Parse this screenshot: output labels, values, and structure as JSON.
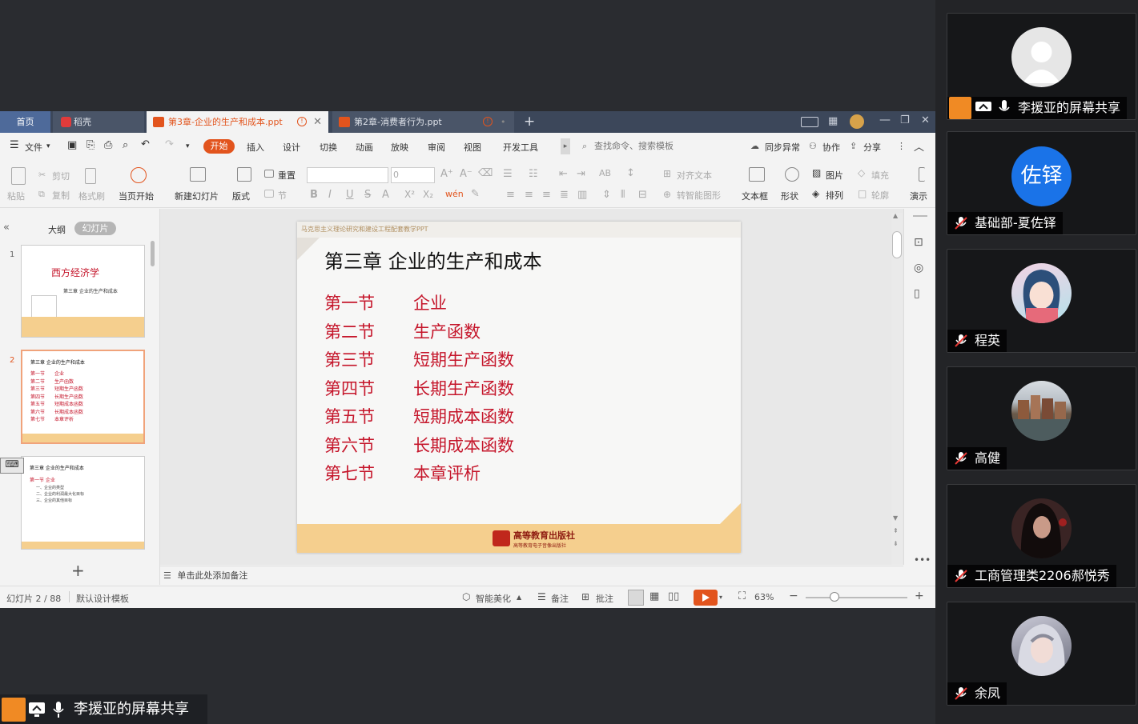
{
  "wps": {
    "tabs": {
      "home": "首页",
      "docer": "稻壳",
      "active": "第3章-企业的生产和成本.ppt",
      "second": "第2章-消费者行为.ppt"
    },
    "menu": {
      "file": "文件",
      "items": [
        "开始",
        "插入",
        "设计",
        "切换",
        "动画",
        "放映",
        "审阅",
        "视图",
        "开发工具"
      ],
      "search_placeholder": "查找命令、搜索模板",
      "sync": "同步异常",
      "collab": "协作",
      "share": "分享"
    },
    "ribbon": {
      "paste": "粘贴",
      "cut": "剪切",
      "copy": "复制",
      "format_painter": "格式刷",
      "from_current": "当页开始",
      "new_slide": "新建幻灯片",
      "layout": "版式",
      "section": "节",
      "reset": "重置",
      "font_size": "0",
      "align_text": "对齐文本",
      "convert_shape": "转智能图形",
      "textbox": "文本框",
      "shape": "形状",
      "picture": "图片",
      "arrange": "排列",
      "fill": "填充",
      "outline": "轮廓",
      "present": "演示"
    },
    "left_panel": {
      "tab_outline": "大纲",
      "tab_slides": "幻灯片",
      "thumb1_title": "西方经济学",
      "thumb1_sub": "第三章  企业的生产和成本",
      "thumb2_title": "第三章  企业的生产和成本",
      "thumb3_title": "第三章  企业的生产和成本",
      "thumb3_sub": "第一节  企业",
      "thumb3_lines": [
        "一、企业的类型",
        "二、企业的利润最大化目标",
        "三、企业的其他目标"
      ]
    },
    "slide": {
      "header": "马克思主义理论研究和建设工程配套教学PPT",
      "title": "第三章   企业的生产和成本",
      "sections": [
        {
          "num": "第一节",
          "name": "企业"
        },
        {
          "num": "第二节",
          "name": "生产函数"
        },
        {
          "num": "第三节",
          "name": "短期生产函数"
        },
        {
          "num": "第四节",
          "name": "长期生产函数"
        },
        {
          "num": "第五节",
          "name": "短期成本函数"
        },
        {
          "num": "第六节",
          "name": "长期成本函数"
        },
        {
          "num": "第七节",
          "name": "本章评析"
        }
      ],
      "publisher": "高等教育出版社",
      "publisher_sub": "高等教育电子音像出版社"
    },
    "notes_placeholder": "单击此处添加备注",
    "status": {
      "slide_counter": "幻灯片 2 / 88",
      "template": "默认设计模板",
      "smart_beautify": "智能美化",
      "notes": "备注",
      "comments": "批注",
      "zoom": "63%"
    }
  },
  "share_label": "李援亚的屏幕共享",
  "participants": [
    {
      "name": "李援亚的屏幕共享",
      "avatar": "default-avatar",
      "muted": false
    },
    {
      "name": "基础部-夏佐铎",
      "avatar_text": "佐铎",
      "avatar_color": "#1a73e8",
      "muted": true
    },
    {
      "name": "程英",
      "avatar": "anime-girl-avatar",
      "muted": true
    },
    {
      "name": "高健",
      "avatar": "canal-photo-avatar",
      "muted": true
    },
    {
      "name": "工商管理类2206郝悦秀",
      "avatar": "dark-hair-avatar",
      "muted": true
    },
    {
      "name": "余凤",
      "avatar": "game-character-avatar",
      "muted": true
    }
  ],
  "colors": {
    "accent": "#e2541d",
    "slide_red": "#c5162b",
    "slide_band": "#f5cf8e",
    "tab_bar": "#3c475a"
  }
}
